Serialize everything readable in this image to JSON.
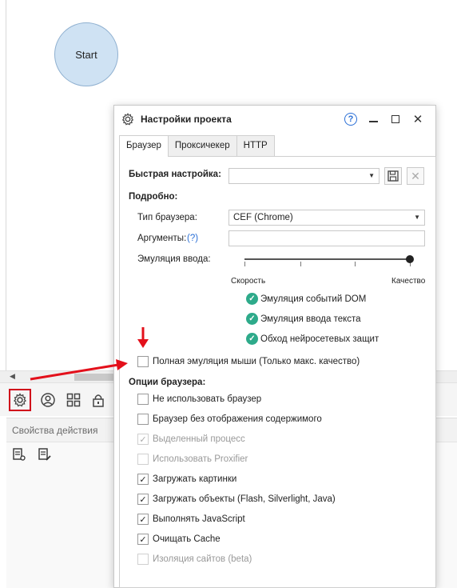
{
  "canvas": {
    "start_node_label": "Start"
  },
  "dialog": {
    "title": "Настройки проекта",
    "tabs": [
      {
        "label": "Браузер",
        "active": true
      },
      {
        "label": "Прокси­чекер",
        "active": false
      },
      {
        "label": "HTTP",
        "active": false
      }
    ],
    "quick_setup_label": "Быстрая настройка:",
    "quick_setup_value": "",
    "details_label": "Подробно:",
    "browser_type_label": "Тип браузера:",
    "browser_type_value": "CEF (Chrome)",
    "args_label": "Аргументы:",
    "args_help": "(?)",
    "args_value": "",
    "input_emulation_label": "Эмуляция ввода:",
    "slider_min_label": "Скорость",
    "slider_max_label": "Качество",
    "slider_value": 1.0,
    "enabled_features": [
      "Эмуляция событий DOM",
      "Эмуляция ввода текста",
      "Обход нейросетевых защит"
    ],
    "full_mouse_emulation": {
      "label": "Полная эмуляция мыши (Только макс. качество)",
      "checked": false
    },
    "browser_options_label": "Опции браузера:",
    "browser_options": [
      {
        "label": "Не использовать браузер",
        "checked": false,
        "disabled": false
      },
      {
        "label": "Браузер без отображения содержимого",
        "checked": false,
        "disabled": false
      },
      {
        "label": "Выделенный процесс",
        "checked": true,
        "disabled": true
      },
      {
        "label": "Использовать Proxifier",
        "checked": false,
        "disabled": true
      },
      {
        "label": "Загружать картинки",
        "checked": true,
        "disabled": false
      },
      {
        "label": "Загружать объекты (Flash, Silverlight, Java)",
        "checked": true,
        "disabled": false
      },
      {
        "label": "Выполнять JavaScript",
        "checked": true,
        "disabled": false
      },
      {
        "label": "Очищать Cache",
        "checked": true,
        "disabled": false
      },
      {
        "label": "Изоляция сайтов (beta)",
        "checked": false,
        "disabled": true
      }
    ]
  },
  "properties_panel": {
    "title": "Свойства действия"
  },
  "colors": {
    "accent": "#2a6fd6",
    "check_green": "#2eaa8a",
    "annotation_red": "#e3101b",
    "start_node_fill": "#cfe2f3"
  }
}
